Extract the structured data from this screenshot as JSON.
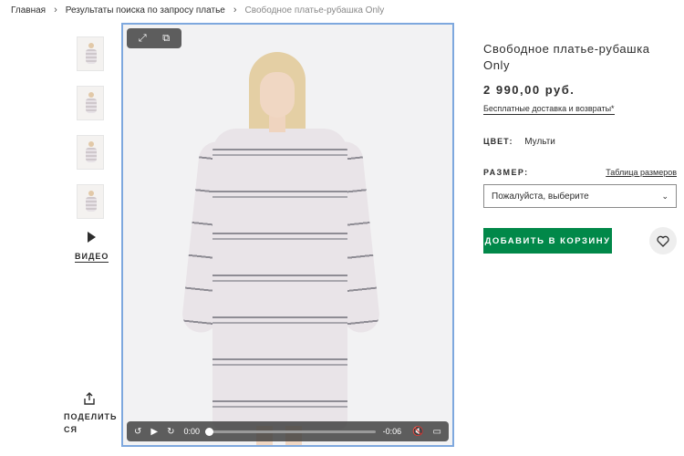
{
  "breadcrumb": {
    "home": "Главная",
    "search": "Результаты поиска по запросу платье",
    "current": "Свободное платье-рубашка Only",
    "separator": "›"
  },
  "gallery": {
    "thumbnails": [
      "thumbnail-1",
      "thumbnail-2",
      "thumbnail-3",
      "thumbnail-4"
    ],
    "video_label": "ВИДЕО",
    "share_label": "ПОДЕЛИТЬСЯ"
  },
  "player": {
    "current_time": "0:00",
    "remaining_time": "-0:06",
    "progress": 0.02,
    "icons": [
      "expand-icon",
      "picture-in-picture-icon",
      "rewind-icon",
      "play-icon",
      "forward-icon",
      "mute-icon",
      "captions-icon"
    ]
  },
  "product": {
    "title": "Свободное платье-рубашка Only",
    "price": "2 990,00 руб.",
    "delivery": "Бесплатные доставка и возвраты*",
    "color_label": "ЦВЕТ:",
    "color_value": "Мульти",
    "size_label": "РАЗМЕР:",
    "size_chart": "Таблица размеров",
    "size_placeholder": "Пожалуйста, выберите",
    "add_to_cart": "ДОБАВИТЬ В КОРЗИНУ"
  },
  "colors": {
    "accent_green": "#018849",
    "focus_border": "#7ea8de"
  }
}
